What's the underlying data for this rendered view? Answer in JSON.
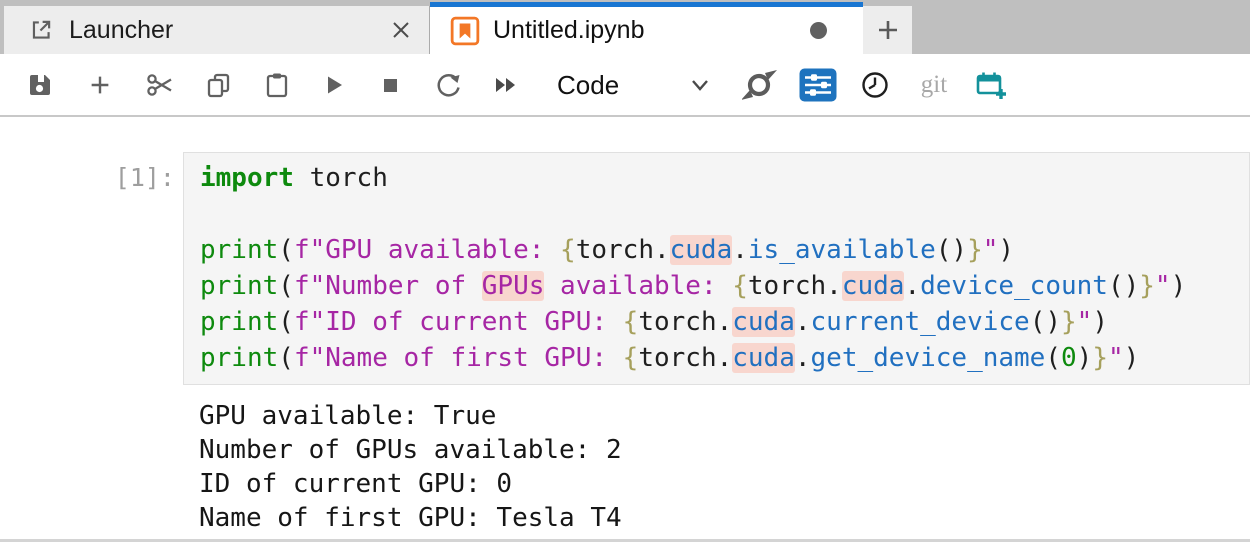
{
  "tabs": {
    "launcher": {
      "label": "Launcher",
      "icon": "external-link-icon"
    },
    "notebook": {
      "label": "Untitled.ipynb",
      "icon": "notebook-orange-icon",
      "unsaved": true
    },
    "new_tab_icon": "plus-icon"
  },
  "toolbar": {
    "cell_type": "Code",
    "git_label": "git",
    "icons": [
      "save-icon",
      "insert-cell-below-icon",
      "cut-icon",
      "copy-icon",
      "paste-icon",
      "run-icon",
      "stop-icon",
      "restart-kernel-icon",
      "restart-run-all-icon",
      "formatter-swoosh-icon",
      "settings-sliders-icon",
      "history-clock-icon",
      "git-label",
      "schedule-calendar-plus-icon"
    ]
  },
  "cell": {
    "prompt": "[1]:",
    "code_lines": [
      [
        [
          "import",
          "kw"
        ],
        [
          " torch",
          "pl"
        ]
      ],
      [],
      [
        [
          "print",
          "bi"
        ],
        [
          "(",
          "pl"
        ],
        [
          "f\"GPU available: ",
          "st"
        ],
        [
          "{",
          "br"
        ],
        [
          "torch.",
          "pl"
        ],
        [
          "cuda",
          "pr hl"
        ],
        [
          ".",
          "pl"
        ],
        [
          "is_available",
          "pr"
        ],
        [
          "()",
          "pl"
        ],
        [
          "}",
          "br"
        ],
        [
          "\"",
          "st"
        ],
        [
          ")",
          "pl"
        ]
      ],
      [
        [
          "print",
          "bi"
        ],
        [
          "(",
          "pl"
        ],
        [
          "f\"Number of ",
          "st"
        ],
        [
          "GPUs",
          "st hl"
        ],
        [
          " available: ",
          "st"
        ],
        [
          "{",
          "br"
        ],
        [
          "torch.",
          "pl"
        ],
        [
          "cuda",
          "pr hl"
        ],
        [
          ".",
          "pl"
        ],
        [
          "device_count",
          "pr"
        ],
        [
          "()",
          "pl"
        ],
        [
          "}",
          "br"
        ],
        [
          "\"",
          "st"
        ],
        [
          ")",
          "pl"
        ]
      ],
      [
        [
          "print",
          "bi"
        ],
        [
          "(",
          "pl"
        ],
        [
          "f\"ID of current GPU: ",
          "st"
        ],
        [
          "{",
          "br"
        ],
        [
          "torch.",
          "pl"
        ],
        [
          "cuda",
          "pr hl"
        ],
        [
          ".",
          "pl"
        ],
        [
          "current_device",
          "pr"
        ],
        [
          "()",
          "pl"
        ],
        [
          "}",
          "br"
        ],
        [
          "\"",
          "st"
        ],
        [
          ")",
          "pl"
        ]
      ],
      [
        [
          "print",
          "bi"
        ],
        [
          "(",
          "pl"
        ],
        [
          "f\"Name of first GPU: ",
          "st"
        ],
        [
          "{",
          "br"
        ],
        [
          "torch.",
          "pl"
        ],
        [
          "cuda",
          "pr hl"
        ],
        [
          ".",
          "pl"
        ],
        [
          "get_device_name",
          "pr"
        ],
        [
          "(",
          "pl"
        ],
        [
          "0",
          "nu"
        ],
        [
          ")",
          "pl"
        ],
        [
          "}",
          "br"
        ],
        [
          "\"",
          "st"
        ],
        [
          ")",
          "pl"
        ]
      ]
    ],
    "outputs": [
      "GPU available: True",
      "Number of GPUs available: 2",
      "ID of current GPU: 0",
      "Name of first GPU: Tesla T4"
    ]
  },
  "colors": {
    "active_tab_accent": "#1976d2",
    "notebook_icon_orange": "#f37726",
    "sliders_icon_blue": "#1e73be",
    "calendar_icon_teal": "#13919b",
    "spellcheck_highlight": "#f8d6ce",
    "keyword_green": "#0e8a0e",
    "string_purple": "#a626a4",
    "property_blue": "#2170c0",
    "fstring_brace_olive": "#a6a05c",
    "toolbar_icon_gray": "#616161"
  }
}
